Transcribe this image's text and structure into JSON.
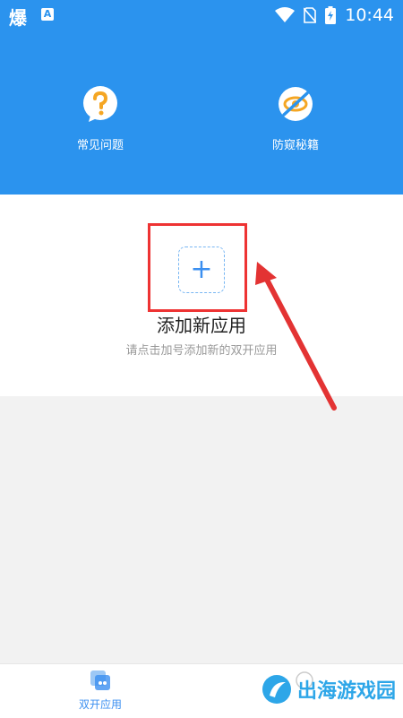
{
  "status_bar": {
    "app_glyph": "爆",
    "a_glyph": "A",
    "time": "10:44"
  },
  "header": {
    "features": [
      {
        "label": "常见问题",
        "icon": "question-bubble-icon"
      },
      {
        "label": "防窥秘籍",
        "icon": "no-peek-eye-icon"
      }
    ]
  },
  "main": {
    "add_symbol": "+",
    "title": "添加新应用",
    "subtitle": "请点击加号添加新的双开应用"
  },
  "bottom_nav": {
    "items": [
      {
        "label": "双开应用",
        "icon": "dual-app-icon",
        "active": true
      }
    ]
  },
  "watermark": {
    "text": "出海游戏园"
  },
  "colors": {
    "header_bg": "#2b93ee",
    "accent": "#3b8ff0",
    "annotation_red": "#e33333",
    "watermark": "#2da6e8"
  }
}
